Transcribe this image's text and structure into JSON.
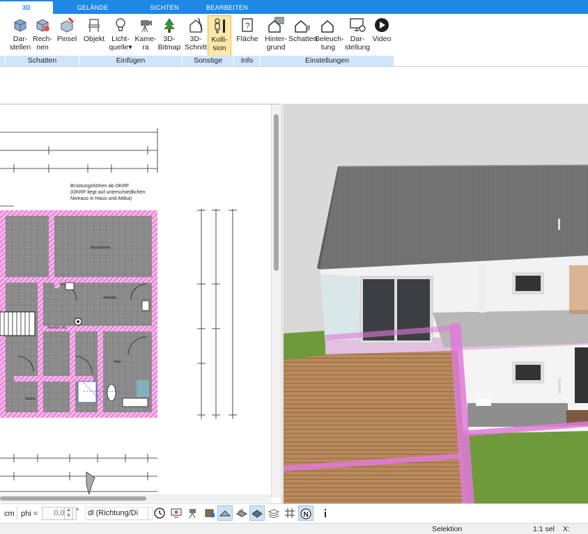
{
  "tabs": [
    {
      "label": "3D",
      "active": true
    },
    {
      "label": "GELÄNDE",
      "active": false
    },
    {
      "label": "SICHTEN",
      "active": false
    },
    {
      "label": "BEARBEITEN",
      "active": false
    }
  ],
  "ribbon": {
    "buttons": [
      {
        "l1": "Dar-",
        "l2": "stellen",
        "icon": "cube-icon"
      },
      {
        "l1": "Rech-",
        "l2": "nen",
        "icon": "cube-calc-icon"
      },
      {
        "l1": "Pinsel",
        "l2": "",
        "icon": "brush-icon"
      },
      {
        "l1": "Objekt",
        "l2": "",
        "icon": "chair-icon"
      },
      {
        "l1": "Licht-",
        "l2": "quelle",
        "icon": "bulb-icon"
      },
      {
        "l1": "Kame-",
        "l2": "ra",
        "icon": "camera-icon"
      },
      {
        "l1": "3D-",
        "l2": "Bitmap",
        "icon": "tree-icon"
      },
      {
        "l1": "3D-",
        "l2": "Schnitt",
        "icon": "section-icon"
      },
      {
        "l1": "Kolli-",
        "l2": "sion",
        "icon": "person-icon",
        "active": true
      },
      {
        "l1": "Fläche",
        "l2": "",
        "icon": "area-info-icon"
      },
      {
        "l1": "Hinter-",
        "l2": "grund",
        "icon": "house-bg-icon"
      },
      {
        "l1": "Schatten",
        "l2": "",
        "icon": "house-shadow-icon"
      },
      {
        "l1": "Beleuch-",
        "l2": "tung",
        "icon": "house-light-icon"
      },
      {
        "l1": "Dar-",
        "l2": "stellung",
        "icon": "monitor-gear-icon"
      },
      {
        "l1": "Video",
        "l2": "",
        "icon": "play-icon"
      }
    ],
    "groups": [
      "Schatten",
      "Einfügen",
      "Sonstige",
      "Info",
      "Einstellungen"
    ]
  },
  "plan": {
    "note_l1": "Brüstungshöhen ab OKRF",
    "note_l2": "(OKRF liegt auf unterschiedlichen",
    "note_l3": "Niveaus in Haus und Attika)",
    "rooms": [
      "Büro/Zimmer",
      "Ankleide",
      "Westflur OG",
      "Bad",
      "Sauna"
    ]
  },
  "toolbar": {
    "unit": "cm",
    "phi_label": "phi =",
    "phi_value": "0,0",
    "degree": "°",
    "direction_select": "dl (Richtung/Di"
  },
  "status": {
    "mode": "Selektion",
    "scale": "1:1 sel",
    "x_label": "X:"
  },
  "colors": {
    "accent": "#1e88e5",
    "group_bg": "#cfe5fb",
    "active_btn": "#fde8a8",
    "wall_pink": "#e040c8"
  }
}
